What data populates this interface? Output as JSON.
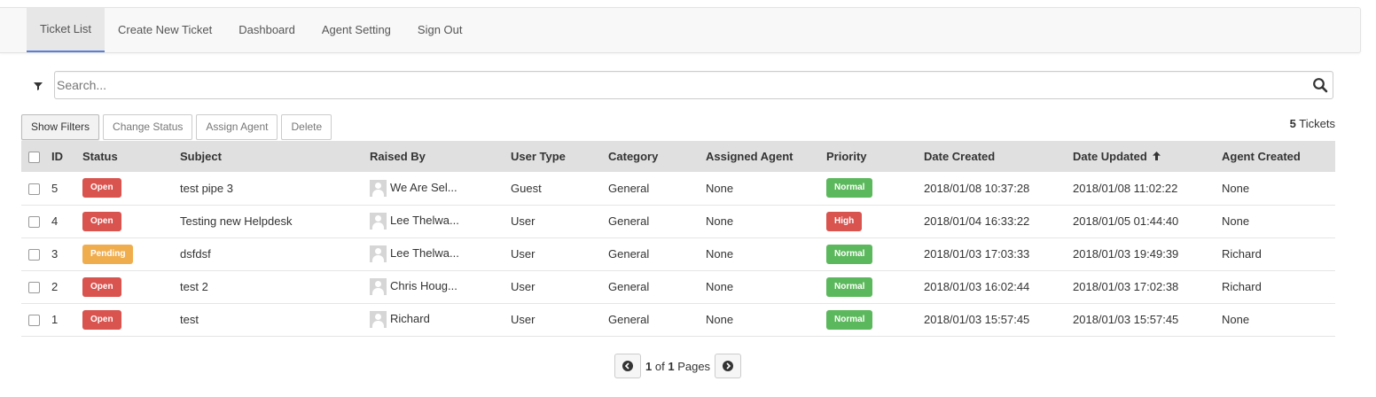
{
  "nav": {
    "tabs": [
      {
        "label": "Ticket List",
        "active": true
      },
      {
        "label": "Create New Ticket"
      },
      {
        "label": "Dashboard"
      },
      {
        "label": "Agent Setting"
      },
      {
        "label": "Sign Out"
      }
    ]
  },
  "search": {
    "placeholder": "Search...",
    "value": ""
  },
  "actions": {
    "show_filters": "Show Filters",
    "change_status": "Change Status",
    "assign_agent": "Assign Agent",
    "delete": "Delete"
  },
  "count": {
    "number": "5",
    "label": "Tickets"
  },
  "table": {
    "columns": [
      "ID",
      "Status",
      "Subject",
      "Raised By",
      "User Type",
      "Category",
      "Assigned Agent",
      "Priority",
      "Date Created",
      "Date Updated",
      "Agent Created"
    ],
    "sorted_column": "Date Updated",
    "sort_direction": "up",
    "rows": [
      {
        "id": "5",
        "status": "Open",
        "status_color": "#d9534f",
        "subject": "test pipe 3",
        "raised_by": "We Are Sel...",
        "user_type": "Guest",
        "category": "General",
        "assigned_agent": "None",
        "priority": "Normal",
        "priority_color": "#5cb85c",
        "date_created": "2018/01/08 10:37:28",
        "date_updated": "2018/01/08 11:02:22",
        "agent_created": "None"
      },
      {
        "id": "4",
        "status": "Open",
        "status_color": "#d9534f",
        "subject": "Testing new Helpdesk",
        "raised_by": "Lee Thelwa...",
        "user_type": "User",
        "category": "General",
        "assigned_agent": "None",
        "priority": "High",
        "priority_color": "#d9534f",
        "date_created": "2018/01/04 16:33:22",
        "date_updated": "2018/01/05 01:44:40",
        "agent_created": "None"
      },
      {
        "id": "3",
        "status": "Pending",
        "status_color": "#f0ad4e",
        "subject": "dsfdsf",
        "raised_by": "Lee Thelwa...",
        "user_type": "User",
        "category": "General",
        "assigned_agent": "None",
        "priority": "Normal",
        "priority_color": "#5cb85c",
        "date_created": "2018/01/03 17:03:33",
        "date_updated": "2018/01/03 19:49:39",
        "agent_created": "Richard"
      },
      {
        "id": "2",
        "status": "Open",
        "status_color": "#d9534f",
        "subject": "test 2",
        "raised_by": "Chris Houg...",
        "user_type": "User",
        "category": "General",
        "assigned_agent": "None",
        "priority": "Normal",
        "priority_color": "#5cb85c",
        "date_created": "2018/01/03 16:02:44",
        "date_updated": "2018/01/03 17:02:38",
        "agent_created": "Richard"
      },
      {
        "id": "1",
        "status": "Open",
        "status_color": "#d9534f",
        "subject": "test",
        "raised_by": "Richard",
        "user_type": "User",
        "category": "General",
        "assigned_agent": "None",
        "priority": "Normal",
        "priority_color": "#5cb85c",
        "date_created": "2018/01/03 15:57:45",
        "date_updated": "2018/01/03 15:57:45",
        "agent_created": "None"
      }
    ]
  },
  "pager": {
    "current": "1",
    "of": "of",
    "total": "1",
    "label": "Pages"
  },
  "icons": {
    "filter": "filter-icon",
    "search": "search-icon",
    "sort": "arrow-up-icon",
    "prev": "chevron-left-circle-icon",
    "next": "chevron-right-circle-icon",
    "avatar": "user-avatar-icon"
  }
}
